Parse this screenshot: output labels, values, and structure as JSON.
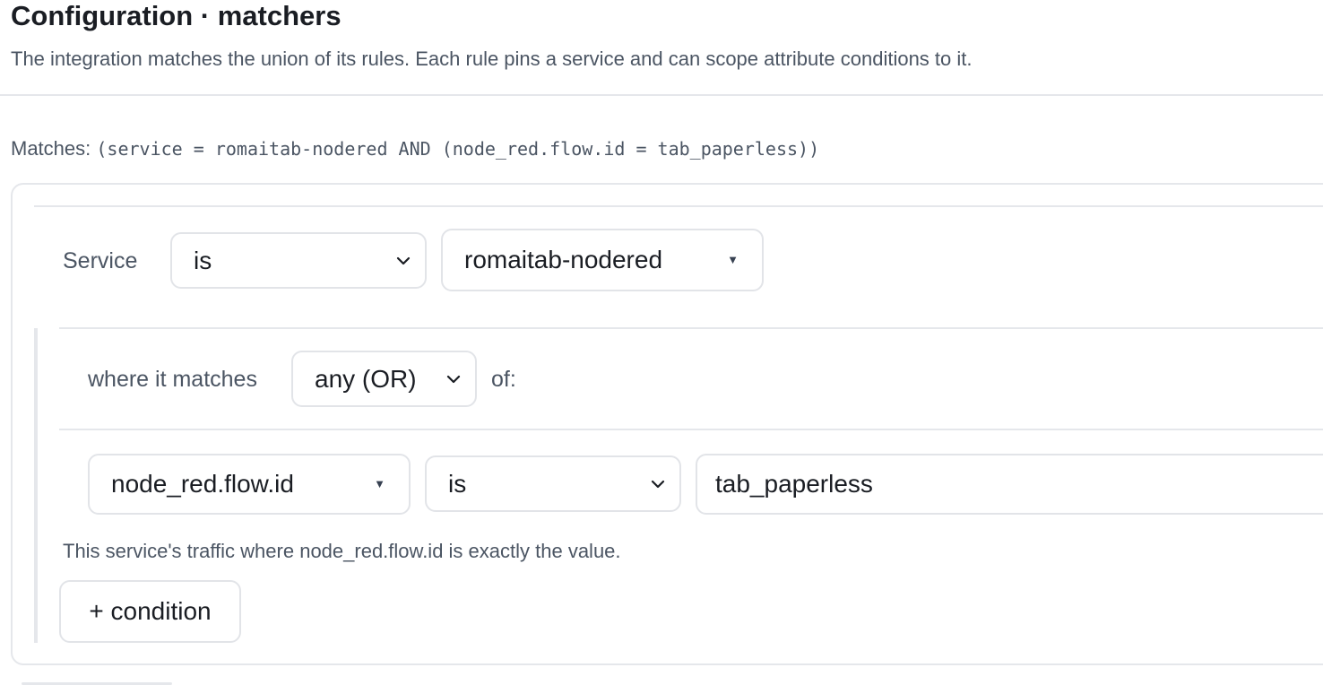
{
  "header": {
    "title": "Configuration · matchers",
    "subtitle": "The integration matches the union of its rules. Each rule pins a service and can scope attribute conditions to it."
  },
  "summary": {
    "label": "Matches:",
    "expression": "(service = romaitab-nodered AND (node_red.flow.id = tab_paperless))"
  },
  "rule": {
    "service_label": "Service",
    "service_operator": "is",
    "service_value": "romaitab-nodered",
    "group": {
      "prefix": "where it matches",
      "mode": "any (OR)",
      "suffix": "of:"
    },
    "condition": {
      "attribute": "node_red.flow.id",
      "operator": "is",
      "value": "tab_paperless",
      "hint": "This service's traffic where node_red.flow.id is exactly the value."
    },
    "add_condition_label": "+ condition"
  },
  "icons": {
    "select_chevron": "chevron-down-icon",
    "combobox_caret": "caret-down-icon"
  },
  "colors": {
    "text": "#1a1d23",
    "muted": "#4b5563",
    "border": "#e2e4e8",
    "divider": "#e5e7eb"
  }
}
